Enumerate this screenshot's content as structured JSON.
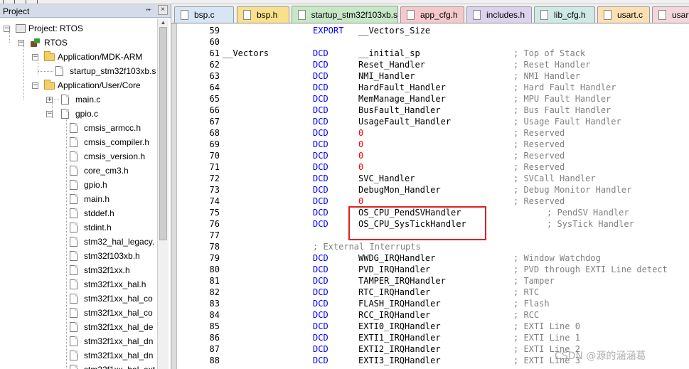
{
  "project_panel": {
    "title": "Project",
    "pin_glyph": "⬰",
    "close_glyph": "×",
    "tree": [
      {
        "label": "Project: RTOS",
        "icon": "project-icon"
      },
      {
        "label": "RTOS",
        "icon": "target-icon"
      },
      {
        "label": "Application/MDK-ARM",
        "icon": "folder-icon"
      },
      {
        "label": "startup_stm32f103xb.s",
        "icon": "file-icon"
      },
      {
        "label": "Application/User/Core",
        "icon": "folder-icon"
      },
      {
        "label": "main.c",
        "icon": "file-icon"
      },
      {
        "label": "gpio.c",
        "icon": "file-icon"
      },
      {
        "label": "cmsis_armcc.h",
        "icon": "file-icon"
      },
      {
        "label": "cmsis_compiler.h",
        "icon": "file-icon"
      },
      {
        "label": "cmsis_version.h",
        "icon": "file-icon"
      },
      {
        "label": "core_cm3.h",
        "icon": "file-icon"
      },
      {
        "label": "gpio.h",
        "icon": "file-icon"
      },
      {
        "label": "main.h",
        "icon": "file-icon"
      },
      {
        "label": "stddef.h",
        "icon": "file-icon"
      },
      {
        "label": "stdint.h",
        "icon": "file-icon"
      },
      {
        "label": "stm32_hal_legacy.",
        "icon": "file-icon"
      },
      {
        "label": "stm32f103xb.h",
        "icon": "file-icon"
      },
      {
        "label": "stm32f1xx.h",
        "icon": "file-icon"
      },
      {
        "label": "stm32f1xx_hal.h",
        "icon": "file-icon"
      },
      {
        "label": "stm32f1xx_hal_co",
        "icon": "file-icon"
      },
      {
        "label": "stm32f1xx_hal_co",
        "icon": "file-icon"
      },
      {
        "label": "stm32f1xx_hal_de",
        "icon": "file-icon"
      },
      {
        "label": "stm32f1xx_hal_dn",
        "icon": "file-icon"
      },
      {
        "label": "stm32f1xx_hal_dn",
        "icon": "file-icon"
      },
      {
        "label": "stm32f1xx_hal_ext",
        "icon": "file-icon"
      }
    ],
    "expanders": [
      "−",
      "−",
      "−",
      "−",
      "+",
      "−"
    ]
  },
  "tabs": [
    {
      "label": "bsp.c",
      "color": "#d6e6f7"
    },
    {
      "label": "bsp.h",
      "color": "#fbe08c"
    },
    {
      "label": "startup_stm32f103xb.s",
      "color": "#c7e7c7",
      "active": true
    },
    {
      "label": "app_cfg.h",
      "color": "#f6c8cc"
    },
    {
      "label": "includes.h",
      "color": "#dcd2ee"
    },
    {
      "label": "lib_cfg.h",
      "color": "#cfeae6"
    },
    {
      "label": "usart.c",
      "color": "#fbe0b4"
    },
    {
      "label": "usart",
      "color": "#f4d6dc"
    }
  ],
  "code": [
    {
      "n": "59",
      "kw": "EXPORT",
      "op": "__Vectors_Size"
    },
    {
      "n": "60"
    },
    {
      "n": "61",
      "label": "__Vectors",
      "kw": "DCD",
      "op": "__initial_sp",
      "cm": "; Top of Stack"
    },
    {
      "n": "62",
      "kw": "DCD",
      "op": "Reset_Handler",
      "cm": "; Reset Handler"
    },
    {
      "n": "63",
      "kw": "DCD",
      "op": "NMI_Handler",
      "cm": "; NMI Handler"
    },
    {
      "n": "64",
      "kw": "DCD",
      "op": "HardFault_Handler",
      "cm": "; Hard Fault Handler"
    },
    {
      "n": "65",
      "kw": "DCD",
      "op": "MemManage_Handler",
      "cm": "; MPU Fault Handler"
    },
    {
      "n": "66",
      "kw": "DCD",
      "op": "BusFault_Handler",
      "cm": "; Bus Fault Handler"
    },
    {
      "n": "67",
      "kw": "DCD",
      "op": "UsageFault_Handler",
      "cm": "; Usage Fault Handler"
    },
    {
      "n": "68",
      "kw": "DCD",
      "op": "0",
      "zero": true,
      "cm": "; Reserved"
    },
    {
      "n": "69",
      "kw": "DCD",
      "op": "0",
      "zero": true,
      "cm": "; Reserved"
    },
    {
      "n": "70",
      "kw": "DCD",
      "op": "0",
      "zero": true,
      "cm": "; Reserved"
    },
    {
      "n": "71",
      "kw": "DCD",
      "op": "0",
      "zero": true,
      "cm": "; Reserved"
    },
    {
      "n": "72",
      "kw": "DCD",
      "op": "SVC_Handler",
      "cm": "; SVCall Handler"
    },
    {
      "n": "73",
      "kw": "DCD",
      "op": "DebugMon_Handler",
      "cm": "; Debug Monitor Handler"
    },
    {
      "n": "74",
      "kw": "DCD",
      "op": "0",
      "zero": true,
      "cm": "; Reserved"
    },
    {
      "n": "75",
      "kw": "DCD",
      "op": "OS_CPU_PendSVHandler",
      "cm": "; PendSV Handler",
      "shift": true
    },
    {
      "n": "76",
      "kw": "DCD",
      "op": "OS_CPU_SysTickHandler",
      "cm": "; SysTick Handler",
      "shift": true
    },
    {
      "n": "77"
    },
    {
      "n": "78",
      "ext": "; External Interrupts"
    },
    {
      "n": "79",
      "kw": "DCD",
      "op": "WWDG_IRQHandler",
      "cm": "; Window Watchdog"
    },
    {
      "n": "80",
      "kw": "DCD",
      "op": "PVD_IRQHandler",
      "cm": "; PVD through EXTI Line detect"
    },
    {
      "n": "81",
      "kw": "DCD",
      "op": "TAMPER_IRQHandler",
      "cm": "; Tamper"
    },
    {
      "n": "82",
      "kw": "DCD",
      "op": "RTC_IRQHandler",
      "cm": "; RTC"
    },
    {
      "n": "83",
      "kw": "DCD",
      "op": "FLASH_IRQHandler",
      "cm": "; Flash"
    },
    {
      "n": "84",
      "kw": "DCD",
      "op": "RCC_IRQHandler",
      "cm": "; RCC"
    },
    {
      "n": "85",
      "kw": "DCD",
      "op": "EXTI0_IRQHandler",
      "cm": "; EXTI Line 0"
    },
    {
      "n": "86",
      "kw": "DCD",
      "op": "EXTI1_IRQHandler",
      "cm": "; EXTI Line 1"
    },
    {
      "n": "87",
      "kw": "DCD",
      "op": "EXTI2_IRQHandler",
      "cm": "; EXTI Line 2"
    },
    {
      "n": "88",
      "kw": "DCD",
      "op": "EXTI3_IRQHandler",
      "cm": "; EXTI Line 3"
    }
  ],
  "watermark": "CSDN @源的涵涵葛"
}
